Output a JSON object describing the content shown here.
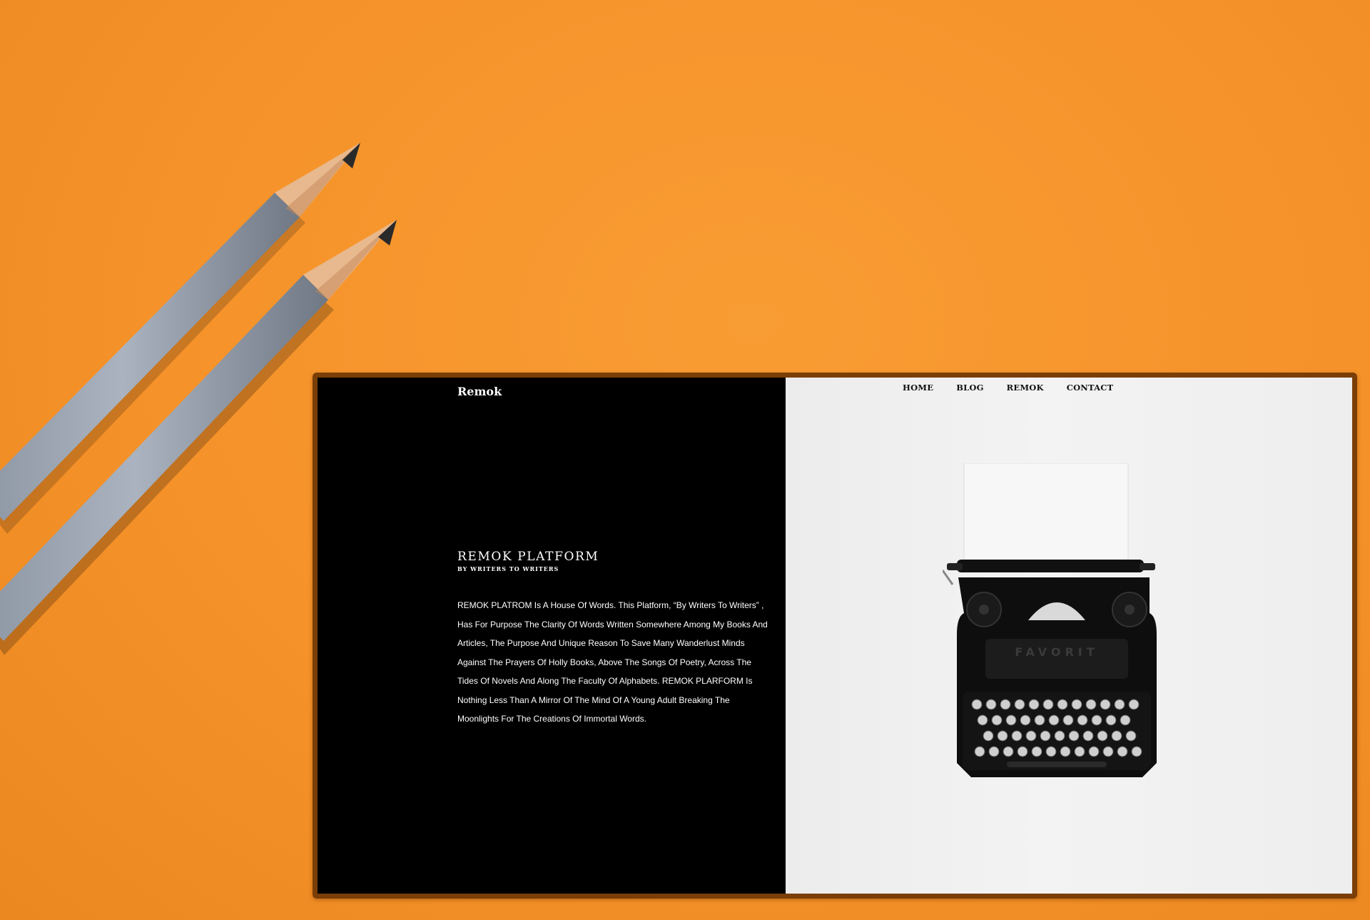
{
  "site": {
    "brand": "Remok",
    "nav": [
      "HOME",
      "BLOG",
      "REMOK",
      "CONTACT"
    ]
  },
  "hero": {
    "title": "REMOK PLATFORM",
    "subtitle": "BY WRITERS TO WRITERS",
    "body": "REMOK PLATROM Is A House Of Words. This Platform, “By Writers To Writers” , Has For Purpose The Clarity Of Words Written Somewhere Among My Books And Articles, The Purpose And Unique Reason To Save Many Wanderlust Minds Against The Prayers Of Holly Books, Above The Songs Of Poetry, Across The Tides Of Novels And Along The Faculty Of Alphabets. REMOK PLARFORM Is Nothing Less Than A Mirror Of The Mind Of A Young Adult Breaking The Moonlights For The Creations Of Immortal Words."
  },
  "typewriter": {
    "brand_plate": "FAVORIT"
  },
  "colors": {
    "background": "#f6922a",
    "frame": "#7a3e06",
    "left_pane": "#000000",
    "right_pane": "#eeeeee"
  }
}
